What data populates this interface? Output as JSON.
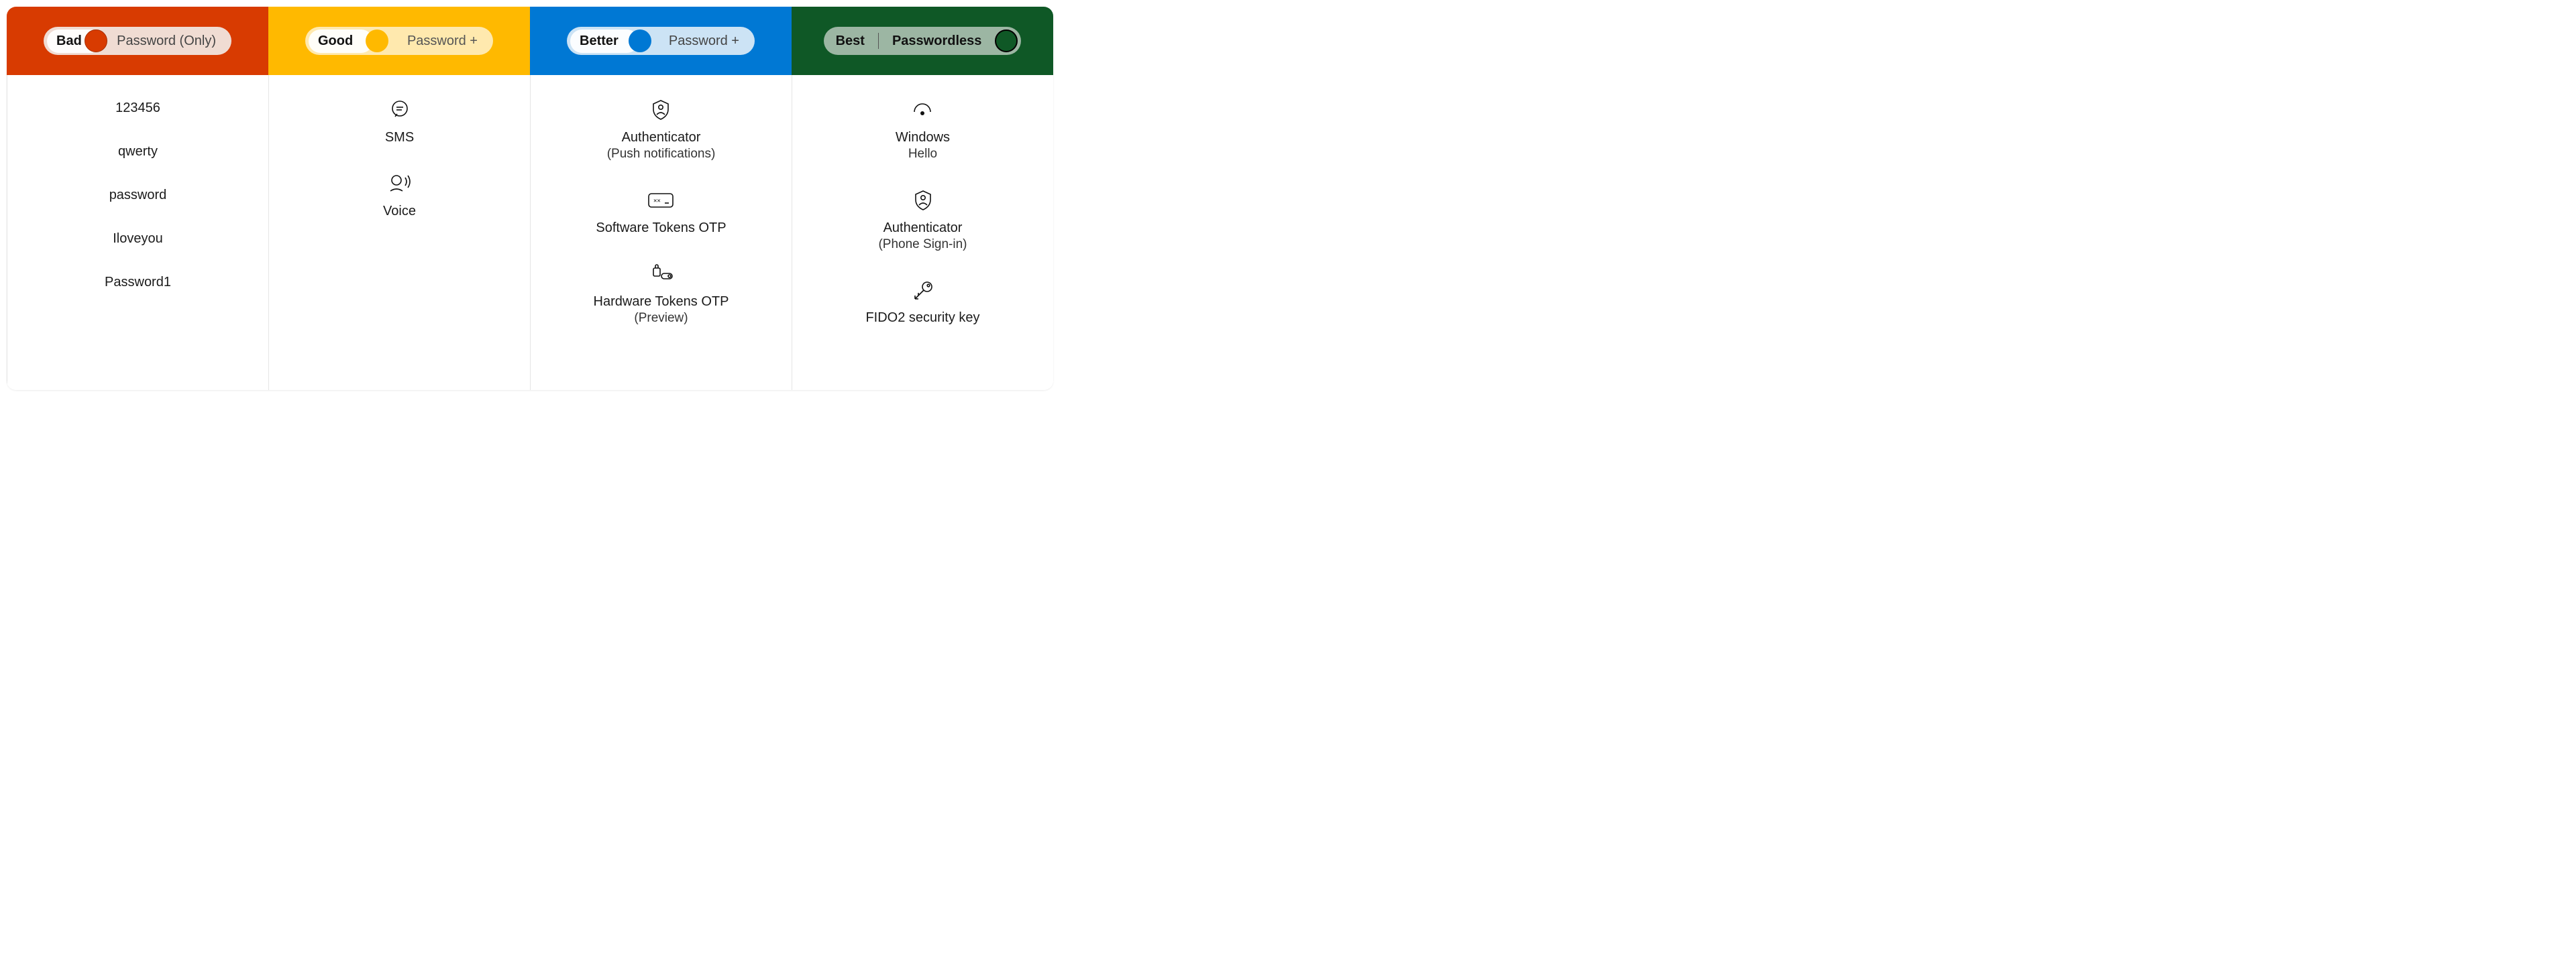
{
  "columns": {
    "bad": {
      "badge": "Bad",
      "desc": "Password (Only)",
      "items": [
        "123456",
        "qwerty",
        "password",
        "Iloveyou",
        "Password1"
      ]
    },
    "good": {
      "badge": "Good",
      "desc": "Password +",
      "items": [
        {
          "label": "SMS"
        },
        {
          "label": "Voice"
        }
      ]
    },
    "better": {
      "badge": "Better",
      "desc": "Password +",
      "items": [
        {
          "label": "Authenticator",
          "sublabel": "(Push notifications)"
        },
        {
          "label": "Software Tokens OTP"
        },
        {
          "label": "Hardware Tokens OTP",
          "sublabel": "(Preview)"
        }
      ]
    },
    "best": {
      "badge": "Best",
      "desc": "Passwordless",
      "items": [
        {
          "label": "Windows",
          "sublabel": "Hello"
        },
        {
          "label": "Authenticator",
          "sublabel": "(Phone Sign-in)"
        },
        {
          "label": "FIDO2 security key"
        }
      ]
    }
  }
}
